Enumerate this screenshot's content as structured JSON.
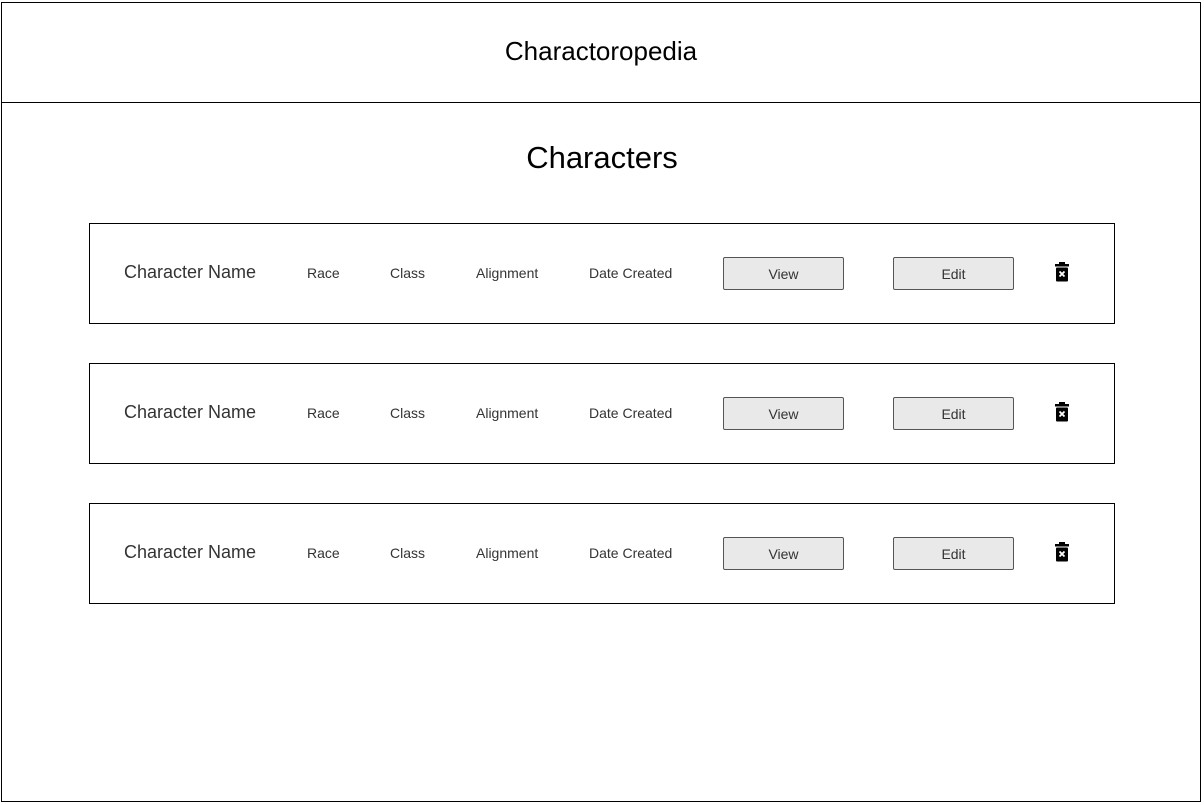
{
  "header": {
    "app_title": "Charactoropedia"
  },
  "main": {
    "page_title": "Characters",
    "characters": [
      {
        "name": "Character Name",
        "race": "Race",
        "class": "Class",
        "alignment": "Alignment",
        "date_created": "Date Created",
        "view_label": "View",
        "edit_label": "Edit",
        "delete_icon": "trash-icon"
      },
      {
        "name": "Character Name",
        "race": "Race",
        "class": "Class",
        "alignment": "Alignment",
        "date_created": "Date Created",
        "view_label": "View",
        "edit_label": "Edit",
        "delete_icon": "trash-icon"
      },
      {
        "name": "Character Name",
        "race": "Race",
        "class": "Class",
        "alignment": "Alignment",
        "date_created": "Date Created",
        "view_label": "View",
        "edit_label": "Edit",
        "delete_icon": "trash-icon"
      }
    ]
  },
  "colors": {
    "border": "#000000",
    "button_bg": "#e9e9e9",
    "text_muted": "#333333"
  }
}
